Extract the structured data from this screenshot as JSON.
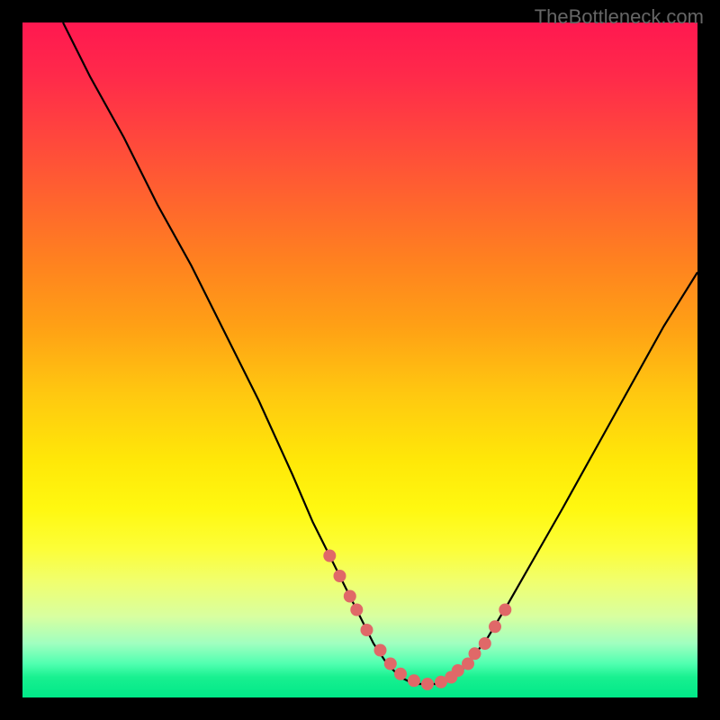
{
  "watermark": "TheBottleneck.com",
  "colors": {
    "dot": "#e06868",
    "curve": "#000000",
    "gradient_top": "#ff1850",
    "gradient_bottom": "#00e888"
  },
  "chart_data": {
    "type": "line",
    "title": "",
    "xlabel": "",
    "ylabel": "",
    "xlim": [
      0,
      100
    ],
    "ylim": [
      0,
      100
    ],
    "note": "Bottleneck-style V-curve. x is normalized position (0-100 across plot width), y is distance-from-optimal percentage (0 at trough, 100 at top). Curve minimum near x≈59.",
    "curve": {
      "x": [
        6,
        10,
        15,
        20,
        25,
        30,
        35,
        40,
        43,
        46,
        49,
        52,
        54,
        56,
        58,
        60,
        62,
        64,
        66,
        69,
        72,
        76,
        80,
        85,
        90,
        95,
        100
      ],
      "y": [
        100,
        92,
        83,
        73,
        64,
        54,
        44,
        33,
        26,
        20,
        14,
        8,
        5,
        3,
        2,
        2,
        2,
        3,
        5,
        9,
        14,
        21,
        28,
        37,
        46,
        55,
        63
      ]
    },
    "dots": {
      "description": "Highlighted sample points near the trough of the curve",
      "x": [
        45.5,
        47,
        48.5,
        49.5,
        51,
        53,
        54.5,
        56,
        58,
        60,
        62,
        63.5,
        64.5,
        66,
        67,
        68.5,
        70,
        71.5
      ],
      "y": [
        21,
        18,
        15,
        13,
        10,
        7,
        5,
        3.5,
        2.5,
        2,
        2.3,
        3,
        4,
        5,
        6.5,
        8,
        10.5,
        13
      ]
    }
  }
}
